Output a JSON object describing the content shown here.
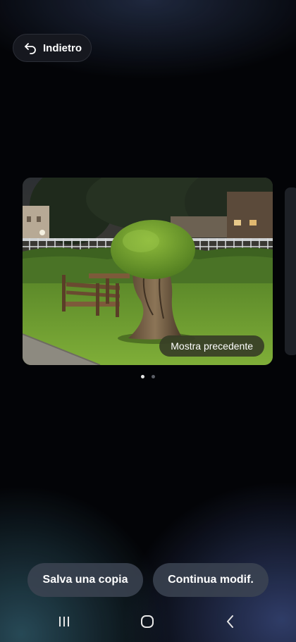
{
  "header": {
    "back_label": "Indietro",
    "back_icon": "arrow-back-icon"
  },
  "preview": {
    "show_previous_label": "Mostra precedente",
    "image_description_icon": "photo-park-topiary-tree",
    "page_indicator": {
      "total": 2,
      "active": 1
    }
  },
  "actions": {
    "save_copy_label": "Salva una copia",
    "continue_edit_label": "Continua modif."
  },
  "navbar": {
    "recents_icon": "recents-icon",
    "home_icon": "home-icon",
    "back_icon": "nav-back-icon"
  },
  "colors": {
    "background": "#030407",
    "button_bg": "#3c4452",
    "show_previous_bg": "#373e26",
    "dot_active": "#e6e6e6",
    "dot_inactive": "#5b5e66"
  }
}
